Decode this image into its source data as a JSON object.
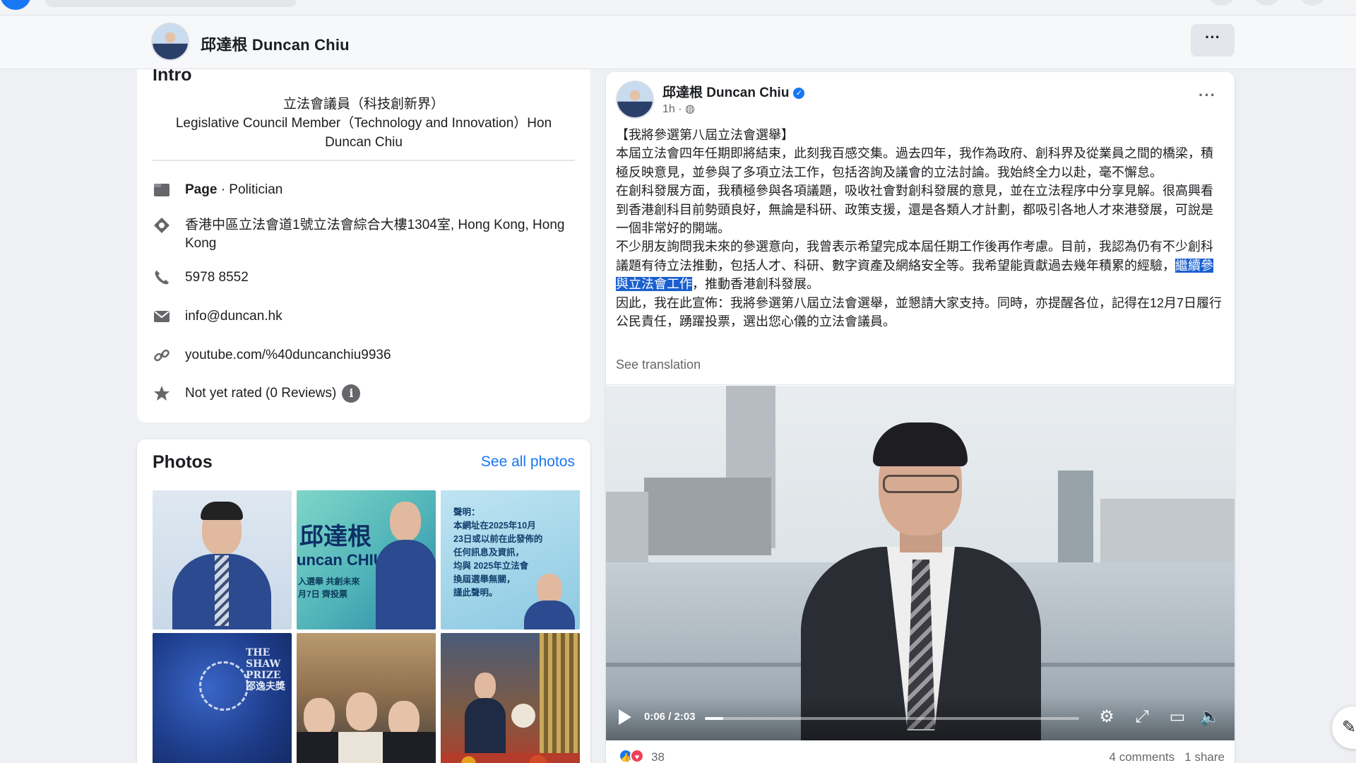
{
  "header": {
    "page_name": "邱達根 Duncan Chiu",
    "more_label": "···"
  },
  "intro": {
    "title": "Intro",
    "bio_line1": "立法會議員（科技創新界）",
    "bio_line2": "Legislative Council Member（Technology and Innovation）Hon Duncan Chiu",
    "category_bold": "Page",
    "category_rest": " · Politician",
    "address": "香港中區立法會道1號立法會綜合大樓1304室, Hong Kong, Hong Kong",
    "phone": "5978 8552",
    "email": "info@duncan.hk",
    "website": "youtube.com/%40duncanchiu9936",
    "rating": "Not yet rated (0 Reviews)",
    "info_glyph": "i"
  },
  "photos": {
    "title": "Photos",
    "see_all": "See all photos",
    "tile2_line1": "邱達根",
    "tile2_line2": "uncan CHIU",
    "tile2_line3": "入選舉 共創未來",
    "tile2_line4": "月7日 齊投票",
    "tile3_lines": "聲明：\n本網址在2025年10月\n23日或以前在此發佈的\n任何訊息及資訊，\n均與 2025年立法會\n換屆選舉無關，\n謹此聲明。",
    "tile4_text": "THE SHAW PRIZE 邵逸夫獎"
  },
  "post": {
    "author": "邱達根 Duncan Chiu",
    "verified_glyph": "✓",
    "time": "1h · ",
    "globe_glyph": "◍",
    "more_label": "···",
    "para1": "【我將參選第八屆立法會選舉】",
    "para2": "本屆立法會四年任期即將結束，此刻我百感交集。過去四年，我作為政府、創科界及從業員之間的橋梁，積極反映意見，並參與了多項立法工作，包括咨詢及議會的立法討論。我始終全力以赴，毫不懈怠。",
    "para3": "在創科發展方面，我積極參與各項議題，吸收社會對創科發展的意見，並在立法程序中分享見解。很高興看到香港創科目前勢頭良好，無論是科研、政策支援，還是各類人才計劃，都吸引各地人才來港發展，可說是一個非常好的開端。",
    "para4_before": "不少朋友詢問我未來的參選意向，我曾表示希望完成本屆任期工作後再作考慮。目前，我認為仍有不少創科議題有待立法推動，包括人才、科研、數字資產及網絡安全等。我希望能貢獻過去幾年積累的經驗，",
    "para4_highlight": "繼續參與立法會工作",
    "para4_after": "，推動香港創科發展。",
    "para5": "因此，我在此宣佈：我將參選第八屆立法會選舉，並懇請大家支持。同時，亦提醒各位，記得在12月7日履行公民責任，踴躍投票，選出您心儀的立法會議員。",
    "see_translation": "See translation"
  },
  "video": {
    "time": "0:06 / 2:03",
    "progress_fraction": 0.049,
    "settings_glyph": "⚙",
    "fullscreen_glyph": "⤢",
    "pip_glyph": "▭",
    "volume_glyph": "🔈"
  },
  "reactions": {
    "like_glyph": "👍",
    "love_glyph": "♥",
    "count": "38",
    "comments_shares": "4 comments   1 share"
  },
  "fab": {
    "edit_glyph": "✎"
  },
  "colors": {
    "accent": "#1877f2",
    "highlight": "#1a5fd0"
  }
}
